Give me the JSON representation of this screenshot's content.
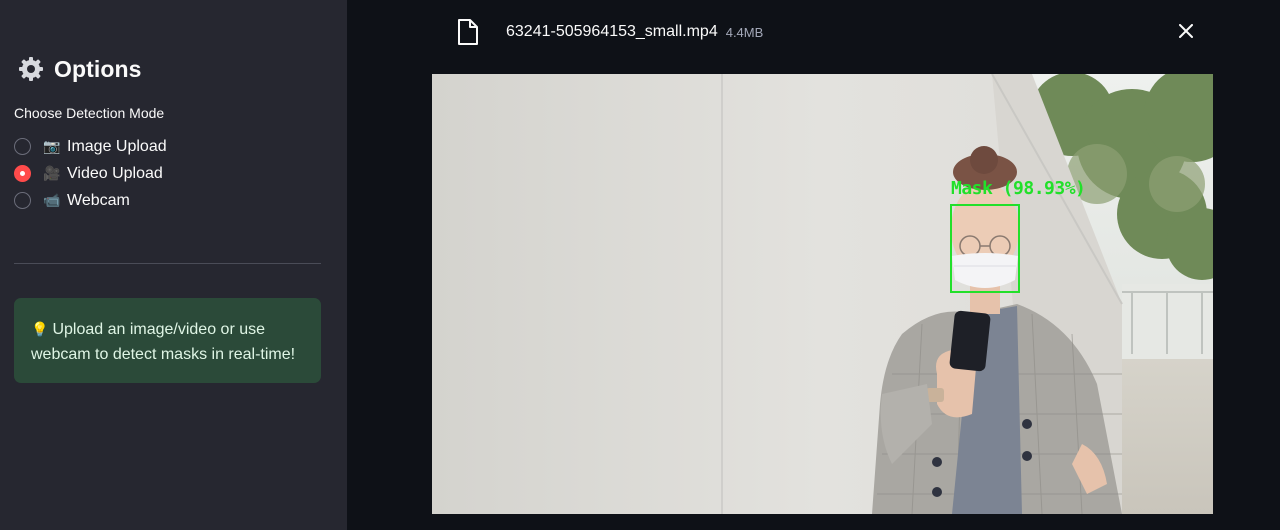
{
  "sidebar": {
    "title": "Options",
    "icon": "gear-icon",
    "radio_label": "Choose Detection Mode",
    "modes": [
      {
        "emoji": "📷",
        "label": "Image Upload",
        "selected": false
      },
      {
        "emoji": "🎥",
        "label": "Video Upload",
        "selected": true
      },
      {
        "emoji": "📹",
        "label": "Webcam",
        "selected": false
      }
    ],
    "info": {
      "emoji": "💡",
      "text": "Upload an image/video or use webcam to detect masks in real-time!"
    }
  },
  "main": {
    "file": {
      "icon": "file-icon",
      "name": "63241-505964153_small.mp4",
      "size": "4.4MB"
    },
    "close_icon": "close-icon",
    "detection": {
      "label": "Mask (98.93%)",
      "color": "#22e02a"
    }
  },
  "colors": {
    "sidebar_bg": "#262730",
    "main_bg": "#0e1117",
    "accent": "#ff4b4b",
    "info_bg": "#2b4a39"
  }
}
